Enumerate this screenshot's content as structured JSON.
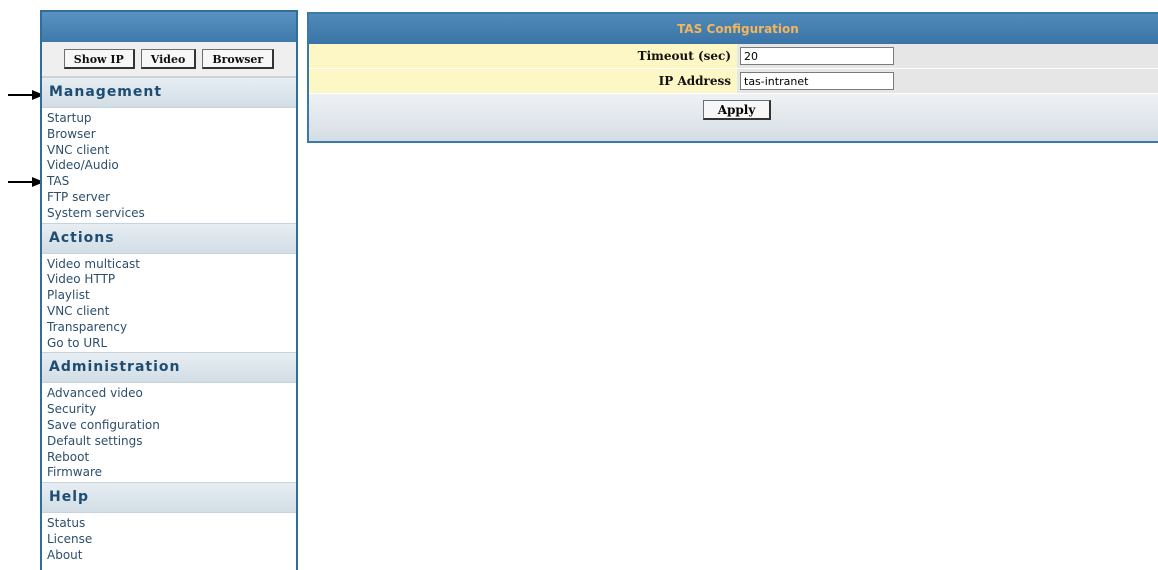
{
  "sidebar": {
    "buttons": [
      {
        "label": "Show IP"
      },
      {
        "label": "Video"
      },
      {
        "label": "Browser"
      }
    ],
    "sections": [
      {
        "title": "Management",
        "items": [
          "Startup",
          "Browser",
          "VNC client",
          "Video/Audio",
          "TAS",
          "FTP server",
          "System services"
        ]
      },
      {
        "title": "Actions",
        "items": [
          "Video multicast",
          "Video HTTP",
          "Playlist",
          "VNC client",
          "Transparency",
          "Go to URL"
        ]
      },
      {
        "title": "Administration",
        "items": [
          "Advanced video",
          "Security",
          "Save configuration",
          "Default settings",
          "Reboot",
          "Firmware"
        ]
      },
      {
        "title": "Help",
        "items": [
          "Status",
          "License",
          "About"
        ]
      }
    ]
  },
  "panel": {
    "title": "TAS Configuration",
    "fields": [
      {
        "label": "Timeout (sec)",
        "value": "20"
      },
      {
        "label": "IP Address",
        "value": "tas-intranet"
      }
    ],
    "apply_label": "Apply"
  },
  "annotations": {
    "arrows": [
      "Management section",
      "TAS menu item"
    ],
    "arrow_icon": "arrow-right-icon"
  }
}
